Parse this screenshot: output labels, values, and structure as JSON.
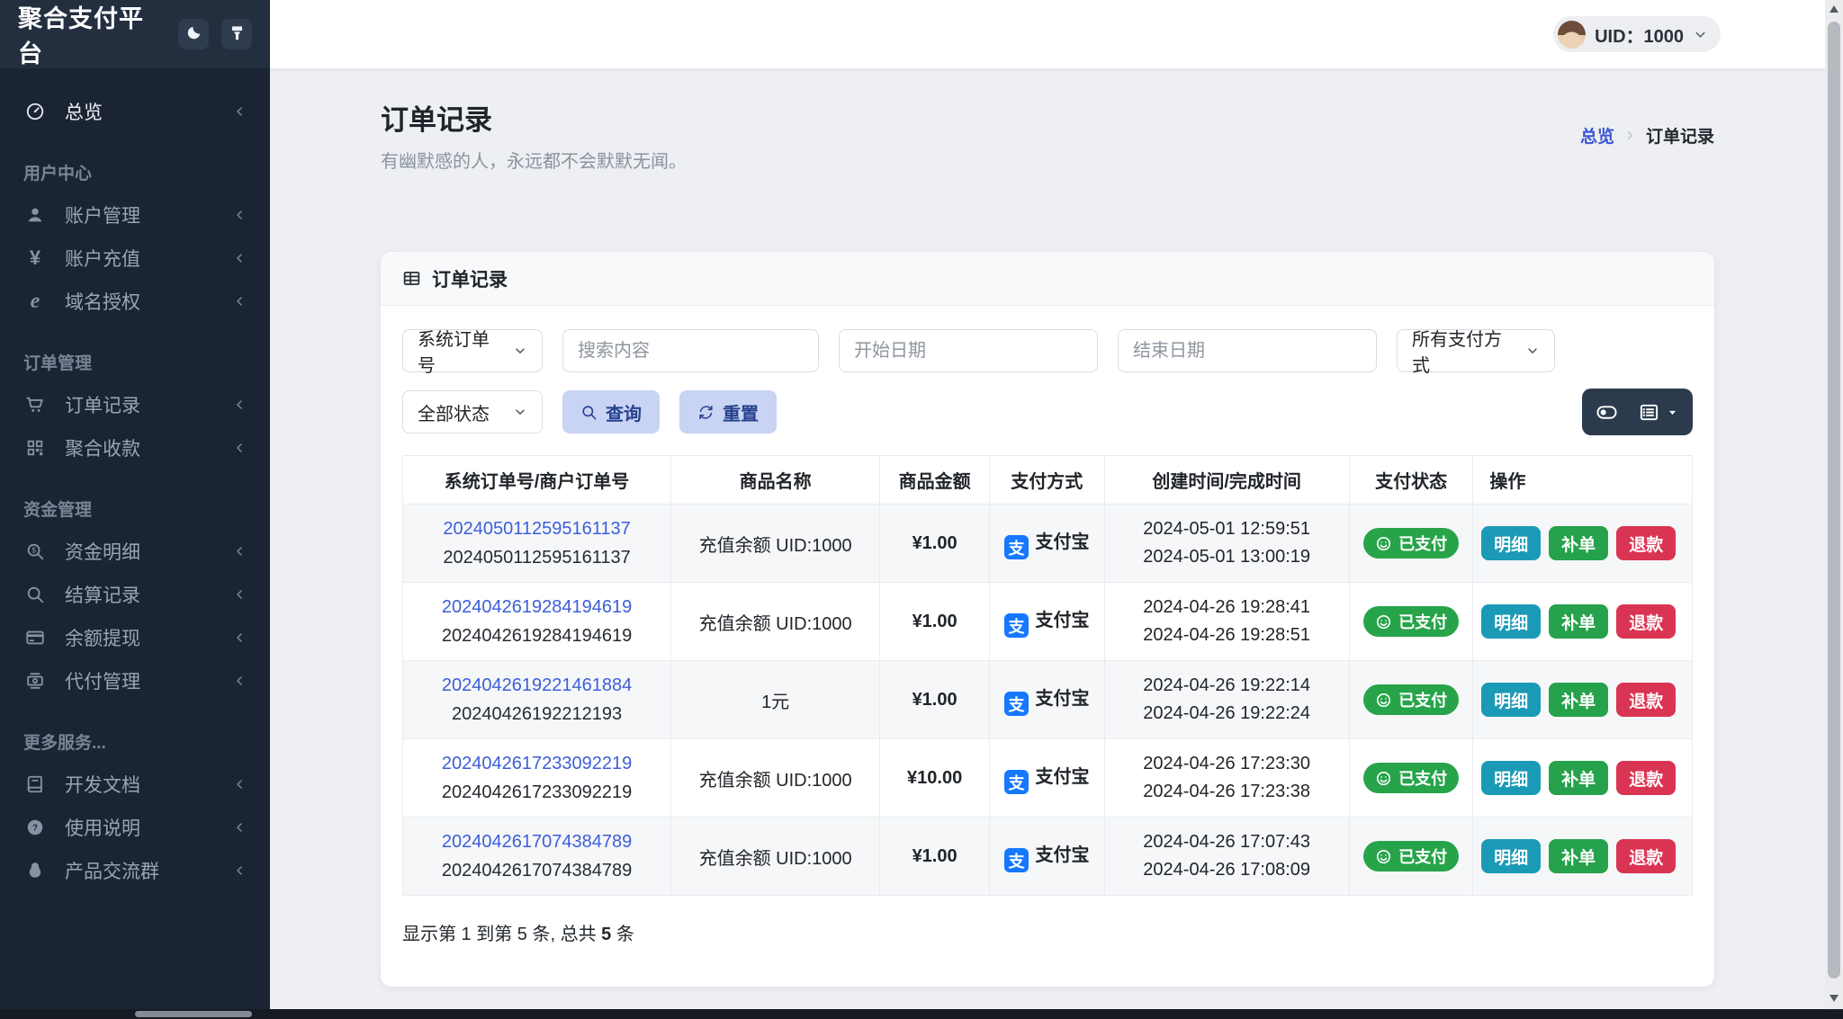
{
  "app": {
    "title": "聚合支付平台",
    "theme_toggle_icon": "moon-icon",
    "skin_icon": "brush-icon"
  },
  "topbar": {
    "uid": "UID：1000",
    "avatar_icon": "user-avatar",
    "chevron_icon": "chevron-down-icon"
  },
  "sidebar": {
    "sections": [
      {
        "items": [
          {
            "label": "总览",
            "icon": "gauge-icon",
            "active": true
          }
        ]
      },
      {
        "header": "用户中心",
        "items": [
          {
            "label": "账户管理",
            "icon": "user-icon",
            "collapsible": true
          },
          {
            "label": "账户充值",
            "icon": "yen-icon"
          },
          {
            "label": "域名授权",
            "icon": "explorer-icon"
          }
        ]
      },
      {
        "header": "订单管理",
        "items": [
          {
            "label": "订单记录",
            "icon": "cart-icon"
          },
          {
            "label": "聚合收款",
            "icon": "qrcode-icon"
          }
        ]
      },
      {
        "header": "资金管理",
        "items": [
          {
            "label": "资金明细",
            "icon": "search-dollar-icon"
          },
          {
            "label": "结算记录",
            "icon": "search-icon"
          },
          {
            "label": "余额提现",
            "icon": "credit-card-icon"
          },
          {
            "label": "代付管理",
            "icon": "transfer-icon"
          }
        ]
      },
      {
        "header": "更多服务...",
        "items": [
          {
            "label": "开发文档",
            "icon": "book-icon"
          },
          {
            "label": "使用说明",
            "icon": "question-icon"
          },
          {
            "label": "产品交流群",
            "icon": "qq-icon"
          }
        ]
      }
    ]
  },
  "page": {
    "title": "订单记录",
    "subtitle": "有幽默感的人，永远都不会默默无闻。",
    "breadcrumb": {
      "parent": "总览",
      "separator_icon": "chevron-right-icon",
      "current": "订单记录"
    }
  },
  "panel": {
    "title": "订单记录",
    "icon": "table-icon"
  },
  "filters": {
    "order_no_type": "系统订单号",
    "search_placeholder": "搜索内容",
    "start_date_placeholder": "开始日期",
    "end_date_placeholder": "结束日期",
    "payment_method": "所有支付方式",
    "status": "全部状态",
    "query": "查询",
    "query_icon": "search-icon",
    "reset": "重置",
    "reset_icon": "refresh-icon",
    "widget_icons": {
      "toggle": "toggle-icon",
      "columns": "list-icon",
      "caret": "caret-down-icon"
    }
  },
  "table": {
    "headers": [
      "系统订单号/商户订单号",
      "商品名称",
      "商品金额",
      "支付方式",
      "创建时间/完成时间",
      "支付状态",
      "操作"
    ],
    "alipay_glyph": "支",
    "rows": [
      {
        "system_no": "2024050112595161137",
        "merchant_no": "2024050112595161137",
        "product": "充值余额 UID:1000",
        "amount": "¥1.00",
        "method": "支付宝",
        "created": "2024-05-01 12:59:51",
        "completed": "2024-05-01 13:00:19",
        "status": "已支付",
        "actions": [
          "明细",
          "补单",
          "退款"
        ]
      },
      {
        "system_no": "2024042619284194619",
        "merchant_no": "2024042619284194619",
        "product": "充值余额 UID:1000",
        "amount": "¥1.00",
        "method": "支付宝",
        "created": "2024-04-26 19:28:41",
        "completed": "2024-04-26 19:28:51",
        "status": "已支付",
        "actions": [
          "明细",
          "补单",
          "退款"
        ]
      },
      {
        "system_no": "2024042619221461884",
        "merchant_no": "20240426192212193",
        "product": "1元",
        "amount": "¥1.00",
        "method": "支付宝",
        "created": "2024-04-26 19:22:14",
        "completed": "2024-04-26 19:22:24",
        "status": "已支付",
        "actions": [
          "明细",
          "补单",
          "退款"
        ]
      },
      {
        "system_no": "2024042617233092219",
        "merchant_no": "2024042617233092219",
        "product": "充值余额 UID:1000",
        "amount": "¥10.00",
        "method": "支付宝",
        "created": "2024-04-26 17:23:30",
        "completed": "2024-04-26 17:23:38",
        "status": "已支付",
        "actions": [
          "明细",
          "补单",
          "退款"
        ]
      },
      {
        "system_no": "2024042617074384789",
        "merchant_no": "2024042617074384789",
        "product": "充值余额 UID:1000",
        "amount": "¥1.00",
        "method": "支付宝",
        "created": "2024-04-26 17:07:43",
        "completed": "2024-04-26 17:08:09",
        "status": "已支付",
        "actions": [
          "明细",
          "补单",
          "退款"
        ]
      }
    ],
    "footer": {
      "prefix": "显示第 1 到第 5 条, 总共 ",
      "total": "5",
      "suffix": " 条"
    },
    "status_icon": "smiley-icon",
    "alipay_icon": "alipay-icon"
  },
  "colors": {
    "accent_link": "#3c5ed8",
    "alipay_blue": "#1678ff",
    "paid_green": "#27a44a",
    "detail_teal": "#1b9ab6",
    "supplement_green": "#25a24b",
    "refund_red": "#da3453",
    "soft_button_bg": "#c9d4f4",
    "soft_button_text": "#27418f",
    "sidebar_bg": "#1b2433",
    "widget_bg": "#2b3a4d"
  }
}
